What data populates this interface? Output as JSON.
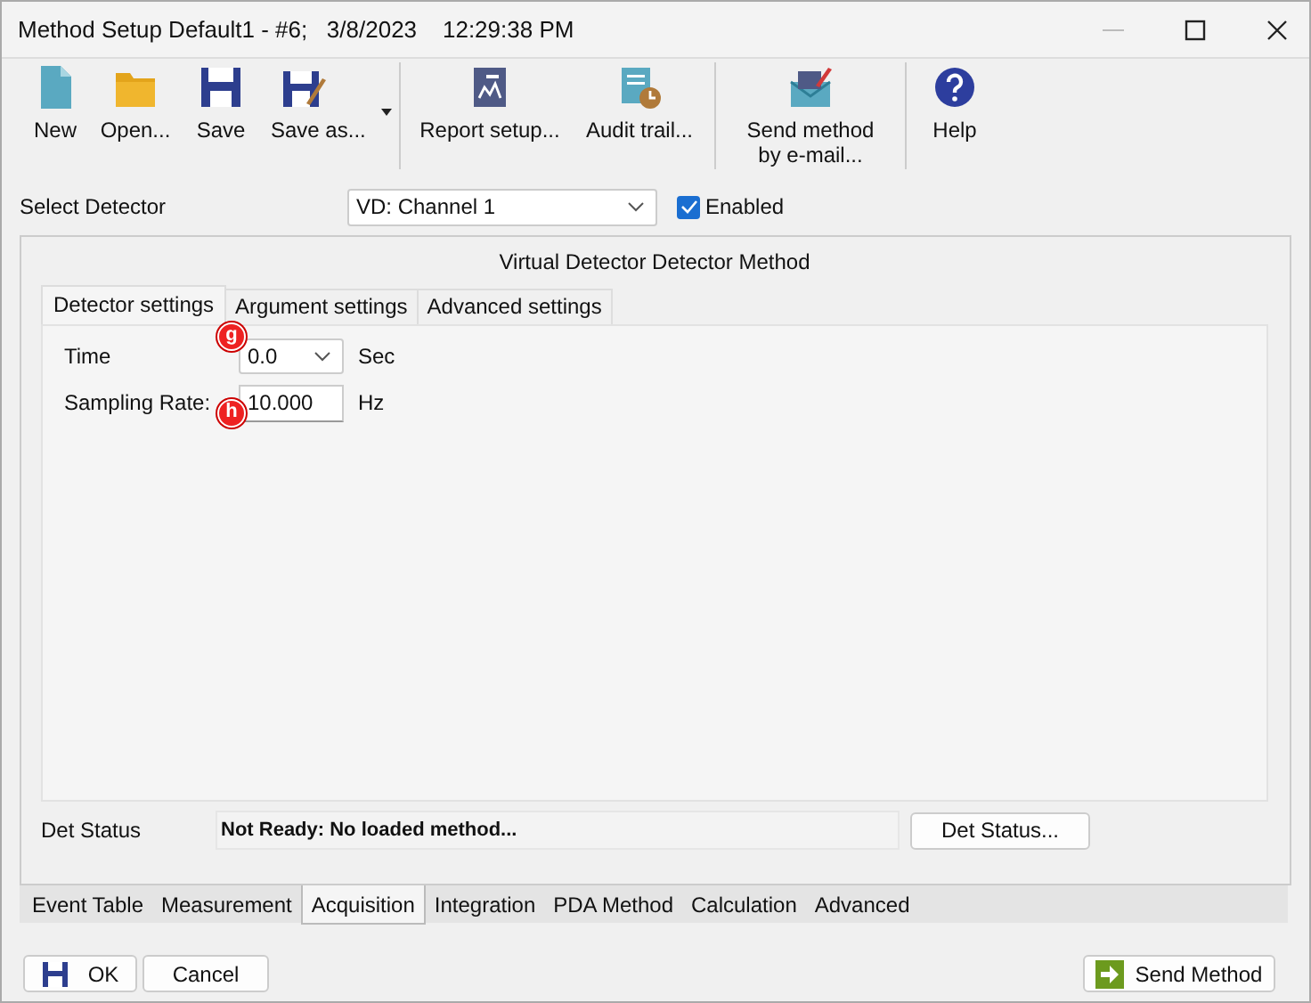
{
  "window": {
    "title": "Method Setup Default1 - #6;   3/8/2023    12:29:38 PM"
  },
  "toolbar": {
    "groups": [
      [
        {
          "kind": "new",
          "label": "New",
          "has_menu": false
        },
        {
          "kind": "open",
          "label": "Open...",
          "has_menu": false
        },
        {
          "kind": "save",
          "label": "Save",
          "has_menu": false
        },
        {
          "kind": "save_as",
          "label": "Save as...",
          "has_menu": true
        }
      ],
      [
        {
          "kind": "report",
          "label": "Report setup...",
          "has_menu": false
        },
        {
          "kind": "audit",
          "label": "Audit trail...",
          "has_menu": false
        }
      ],
      [
        {
          "kind": "email",
          "label": "Send method by e-mail...",
          "has_menu": false
        }
      ],
      [
        {
          "kind": "help",
          "label": "Help",
          "has_menu": false
        }
      ]
    ]
  },
  "detector": {
    "label": "Select Detector",
    "value": "VD: Channel 1",
    "enabled": {
      "label": "Enabled",
      "checked": true
    }
  },
  "group": {
    "title": "Virtual Detector Detector Method",
    "tabs": [
      {
        "label": "Detector settings",
        "selected": true
      },
      {
        "label": "Argument settings",
        "selected": false
      },
      {
        "label": "Advanced settings",
        "selected": false
      }
    ],
    "fields": [
      {
        "kind": "dropdown",
        "label": "Time",
        "value": "0.0",
        "unit": "Sec",
        "callout": "g"
      },
      {
        "kind": "input",
        "label": "Sampling Rate:",
        "value": "10.000",
        "unit": "Hz",
        "callout": "h"
      }
    ],
    "status": {
      "label": "Det Status",
      "value": "Not Ready: No loaded method...",
      "button": "Det Status..."
    }
  },
  "bottom_tabs": [
    {
      "label": "Event Table",
      "selected": false
    },
    {
      "label": "Measurement",
      "selected": false
    },
    {
      "label": "Acquisition",
      "selected": true
    },
    {
      "label": "Integration",
      "selected": false
    },
    {
      "label": "PDA Method",
      "selected": false
    },
    {
      "label": "Calculation",
      "selected": false
    },
    {
      "label": "Advanced",
      "selected": false
    }
  ],
  "buttons": {
    "ok": "OK",
    "cancel": "Cancel",
    "send": "Send Method"
  }
}
